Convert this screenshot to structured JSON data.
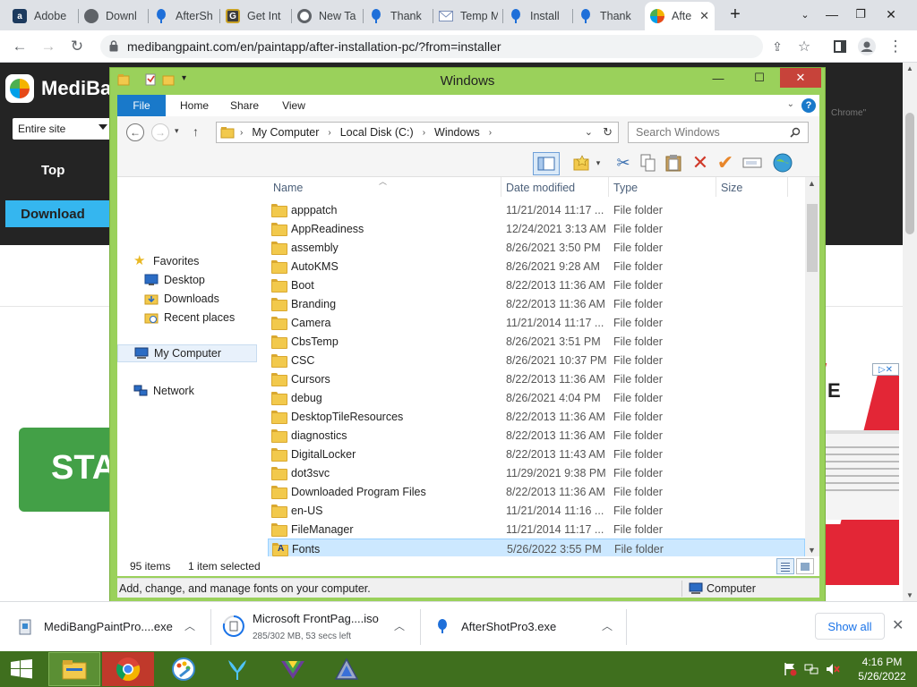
{
  "browser": {
    "tabs": [
      {
        "label": "Adobe",
        "icon": "adobe-icon",
        "color": "#1c3a5e",
        "glyph": "a"
      },
      {
        "label": "Downl",
        "icon": "globe-icon",
        "color": "#5f6368",
        "glyph": ""
      },
      {
        "label": "AfterSh",
        "icon": "aftershot-icon",
        "color": "#1e6fd9",
        "glyph": ""
      },
      {
        "label": "Get Int",
        "icon": "getinto-icon",
        "color": "#3c3c3c",
        "glyph": "G"
      },
      {
        "label": "New Ta",
        "icon": "chrome-icon",
        "color": "#5f6368",
        "glyph": ""
      },
      {
        "label": "Thank",
        "icon": "aftershot-icon",
        "color": "#1e6fd9",
        "glyph": ""
      },
      {
        "label": "Temp M",
        "icon": "mail-icon",
        "color": "#7b8fb8",
        "glyph": ""
      },
      {
        "label": "Install",
        "icon": "aftershot-icon",
        "color": "#1e6fd9",
        "glyph": ""
      },
      {
        "label": "Thank",
        "icon": "aftershot-icon",
        "color": "#1e6fd9",
        "glyph": ""
      },
      {
        "label": "Afte",
        "icon": "medibang-icon",
        "color": "#4caf50",
        "glyph": ""
      }
    ],
    "new_tab": "+",
    "url": "medibangpaint.com/en/paintapp/after-installation-pc/?from=installer"
  },
  "website": {
    "logo_text": "MediBa",
    "select_value": "Entire site",
    "nav_top": "Top",
    "download_button": "Download",
    "chrome_note": "Chrome\"",
    "start_button": "STA",
    "ad_letter": "E"
  },
  "explorer": {
    "title": "Windows",
    "ribbon_tabs": [
      "File",
      "Home",
      "Share",
      "View"
    ],
    "breadcrumb": [
      "My Computer",
      "Local Disk (C:)",
      "Windows"
    ],
    "search_placeholder": "Search Windows",
    "nav": {
      "favorites": "Favorites",
      "desktop": "Desktop",
      "downloads": "Downloads",
      "recent": "Recent places",
      "computer": "My Computer",
      "network": "Network"
    },
    "columns": [
      "Name",
      "Date modified",
      "Type",
      "Size"
    ],
    "files": [
      {
        "name": "apppatch",
        "date": "11/21/2014 11:17 ...",
        "type": "File folder"
      },
      {
        "name": "AppReadiness",
        "date": "12/24/2021 3:13 AM",
        "type": "File folder"
      },
      {
        "name": "assembly",
        "date": "8/26/2021 3:50 PM",
        "type": "File folder"
      },
      {
        "name": "AutoKMS",
        "date": "8/26/2021 9:28 AM",
        "type": "File folder"
      },
      {
        "name": "Boot",
        "date": "8/22/2013 11:36 AM",
        "type": "File folder"
      },
      {
        "name": "Branding",
        "date": "8/22/2013 11:36 AM",
        "type": "File folder"
      },
      {
        "name": "Camera",
        "date": "11/21/2014 11:17 ...",
        "type": "File folder"
      },
      {
        "name": "CbsTemp",
        "date": "8/26/2021 3:51 PM",
        "type": "File folder"
      },
      {
        "name": "CSC",
        "date": "8/26/2021 10:37 PM",
        "type": "File folder"
      },
      {
        "name": "Cursors",
        "date": "8/22/2013 11:36 AM",
        "type": "File folder"
      },
      {
        "name": "debug",
        "date": "8/26/2021 4:04 PM",
        "type": "File folder"
      },
      {
        "name": "DesktopTileResources",
        "date": "8/22/2013 11:36 AM",
        "type": "File folder"
      },
      {
        "name": "diagnostics",
        "date": "8/22/2013 11:36 AM",
        "type": "File folder"
      },
      {
        "name": "DigitalLocker",
        "date": "8/22/2013 11:43 AM",
        "type": "File folder"
      },
      {
        "name": "dot3svc",
        "date": "11/29/2021 9:38 PM",
        "type": "File folder"
      },
      {
        "name": "Downloaded Program Files",
        "date": "8/22/2013 11:36 AM",
        "type": "File folder"
      },
      {
        "name": "en-US",
        "date": "11/21/2014 11:16 ...",
        "type": "File folder"
      },
      {
        "name": "FileManager",
        "date": "11/21/2014 11:17 ...",
        "type": "File folder"
      },
      {
        "name": "Fonts",
        "date": "5/26/2022 3:55 PM",
        "type": "File folder",
        "selected": true
      }
    ],
    "status_count": "95 items",
    "status_selected": "1 item selected",
    "status_hint": "Add, change, and manage fonts on your computer.",
    "status_location": "Computer"
  },
  "downloads": [
    {
      "name": "MediBangPaintPro....exe",
      "sub": ""
    },
    {
      "name": "Microsoft FrontPag....iso",
      "sub": "285/302 MB, 53 secs left"
    },
    {
      "name": "AfterShotPro3.exe",
      "sub": ""
    }
  ],
  "downloads_show_all": "Show all",
  "clock": {
    "time": "4:16 PM",
    "date": "5/26/2022"
  },
  "colors": {
    "taskbar": "#3f6f1e",
    "window_frame": "#9ad15b",
    "accent_blue": "#1979ca",
    "close_red": "#c7433a"
  }
}
